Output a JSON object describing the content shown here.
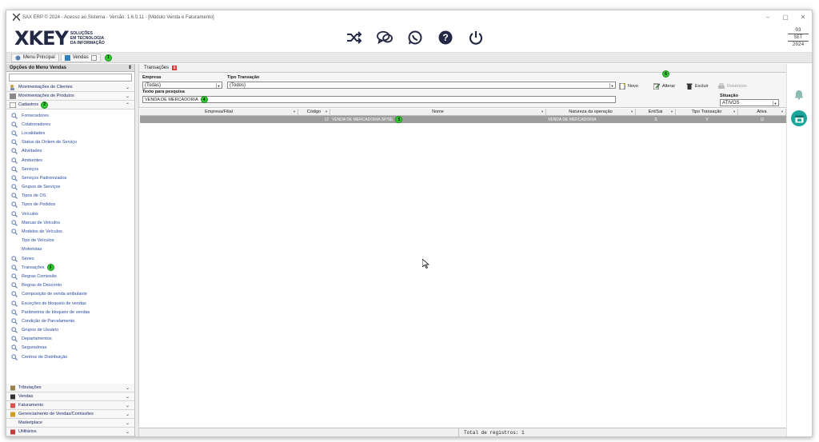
{
  "window": {
    "title": "SAX ERP © 2024 - Acesso ao Sistema - Versão: 1.6.0.11 - [Módulo Venda e Faturamento]",
    "controls": [
      "–",
      "▢",
      "✕"
    ]
  },
  "brand": {
    "mark": "XKEY",
    "sub_line1": "SOLUÇÕES",
    "sub_line2": "EM TECNOLOGIA",
    "sub_line3": "DA INFORMAÇÃO"
  },
  "toolbar_icons": [
    "shuffle-icon",
    "chat-icon",
    "whatsapp-icon",
    "help-icon",
    "power-icon"
  ],
  "date": {
    "day": "03",
    "month": "SET",
    "year": "2024"
  },
  "app_tabs": [
    {
      "label": "Menu Principal"
    },
    {
      "label": "Vendas"
    }
  ],
  "markers": {
    "m1": "1",
    "m2": "2",
    "m3": "3",
    "m4": "4",
    "m5": "5",
    "m6": "6"
  },
  "sidebar": {
    "title": "Opções do Menu Vendas",
    "groups_top": [
      {
        "label": "Movimentações de Clientes",
        "chevron": "⌄"
      },
      {
        "label": "Movimentações de Produtos",
        "chevron": "⌄"
      },
      {
        "label": "Cadastros",
        "chevron": "⌃"
      }
    ],
    "items": [
      {
        "label": "Fornecedores",
        "icon": true
      },
      {
        "label": "Colaboradores",
        "icon": true
      },
      {
        "label": "Localidades",
        "icon": true
      },
      {
        "label": "Status da Ordem de Serviço",
        "icon": true
      },
      {
        "label": "Atividades",
        "icon": true
      },
      {
        "label": "Ambientes",
        "icon": true
      },
      {
        "label": "Serviços",
        "icon": true
      },
      {
        "label": "Serviços Padronizados",
        "icon": true
      },
      {
        "label": "Grupos de Serviços",
        "icon": true
      },
      {
        "label": "Tipos de OS",
        "icon": true
      },
      {
        "label": "Tipos de Pedidos",
        "icon": true
      },
      {
        "label": "Veículos",
        "icon": true
      },
      {
        "label": "Marcas de Veículos",
        "icon": true
      },
      {
        "label": "Modelos de Veículos",
        "icon": true
      },
      {
        "label": "Tipo de Veículos",
        "icon": false
      },
      {
        "label": "Motoristas",
        "icon": false
      },
      {
        "label": "Séries",
        "icon": true
      },
      {
        "label": "Transações",
        "icon": true
      },
      {
        "label": "Regras Comissão",
        "icon": true
      },
      {
        "label": "Regras de Desconto",
        "icon": true
      },
      {
        "label": "Composição de venda ambulante",
        "icon": true
      },
      {
        "label": "Exceções de bloqueio de vendas",
        "icon": true
      },
      {
        "label": "Parâmetros de bloqueio de vendas",
        "icon": true
      },
      {
        "label": "Condição de Parcelamento",
        "icon": true
      },
      {
        "label": "Grupos de Usuário",
        "icon": true
      },
      {
        "label": "Departamentos",
        "icon": true
      },
      {
        "label": "Seguradoras",
        "icon": true
      },
      {
        "label": "Centros de Distribuição",
        "icon": true
      }
    ],
    "groups_bottom": [
      {
        "label": "Tributações",
        "chevron": "⌄"
      },
      {
        "label": "Vendas",
        "chevron": "⌄"
      },
      {
        "label": "Faturamento",
        "chevron": "⌄"
      },
      {
        "label": "Gerenciamento de Vendas/Comissões",
        "chevron": "⌄"
      },
      {
        "label": "Marketplace",
        "chevron": "⌄"
      },
      {
        "label": "Utilitários",
        "chevron": "⌄"
      }
    ]
  },
  "doc_tab": {
    "label": "Transações",
    "close": "x"
  },
  "filters": {
    "empresa_label": "Empresa",
    "empresa_value": "(Todas)",
    "tipo_label": "Tipo Transação",
    "tipo_value": "(Todos)",
    "texto_label": "Texto para pesquisa",
    "texto_value": "VENDA DE MERCADORIA",
    "situacao_label": "Situação",
    "situacao_value": "ATIVOS"
  },
  "actions": {
    "novo": "Novo",
    "alterar": "Alterar",
    "excluir": "Excluir",
    "relatorios": "Relatórios"
  },
  "grid": {
    "columns": [
      "Empresa/Filial",
      "Código",
      "Nome",
      "Natureza da operação",
      "Ent/Sai",
      "Tipo Transação",
      "Ativa"
    ],
    "rows": [
      {
        "empresa": "",
        "codigo": "12",
        "nome": "VENDA DE MERCADORIA SP/SE",
        "natureza": "VENDA DE MERCADORIA",
        "entsai": "S",
        "tipo": "V",
        "ativa": "☑"
      }
    ]
  },
  "status": {
    "total": "Total de registros: 1"
  }
}
